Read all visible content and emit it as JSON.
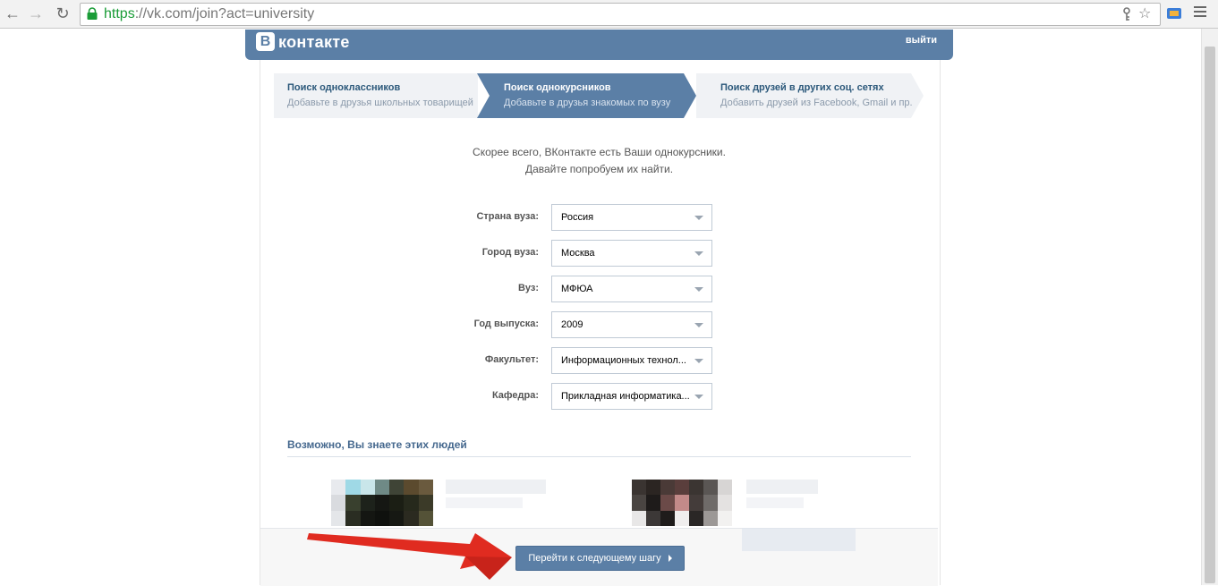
{
  "browser": {
    "url_scheme": "https",
    "url_rest": "://vk.com/join?act=university",
    "back_icon": "←",
    "forward_icon": "→",
    "reload_icon": "↻",
    "key_icon": "key-icon",
    "star_icon": "☆"
  },
  "header": {
    "logo_letter": "В",
    "logo_text": "контакте",
    "exit_label": "выйти"
  },
  "steps": [
    {
      "title": "Поиск одноклассников",
      "subtitle": "Добавьте в друзья школьных товарищей",
      "active": false
    },
    {
      "title": "Поиск однокурсников",
      "subtitle": "Добавьте в друзья знакомых по вузу",
      "active": true
    },
    {
      "title": "Поиск друзей в других соц. сетях",
      "subtitle": "Добавить друзей из Facebook, Gmail и пр.",
      "active": false
    }
  ],
  "intro": {
    "line1": "Скорее всего, ВКонтакте есть Ваши однокурсники.",
    "line2": "Давайте попробуем их найти."
  },
  "form": [
    {
      "label": "Страна вуза:",
      "value": "Россия"
    },
    {
      "label": "Город вуза:",
      "value": "Москва"
    },
    {
      "label": "Вуз:",
      "value": "МФЮА"
    },
    {
      "label": "Год выпуска:",
      "value": "2009"
    },
    {
      "label": "Факультет:",
      "value": "Информационных технол..."
    },
    {
      "label": "Кафедра:",
      "value": "Прикладная информатика..."
    }
  ],
  "suggestions": {
    "title": "Возможно, Вы знаете этих людей"
  },
  "footer": {
    "next_label": "Перейти к следующему шагу"
  },
  "colors": {
    "accent": "#5b7fa6",
    "annotation_arrow": "#e02b20"
  }
}
